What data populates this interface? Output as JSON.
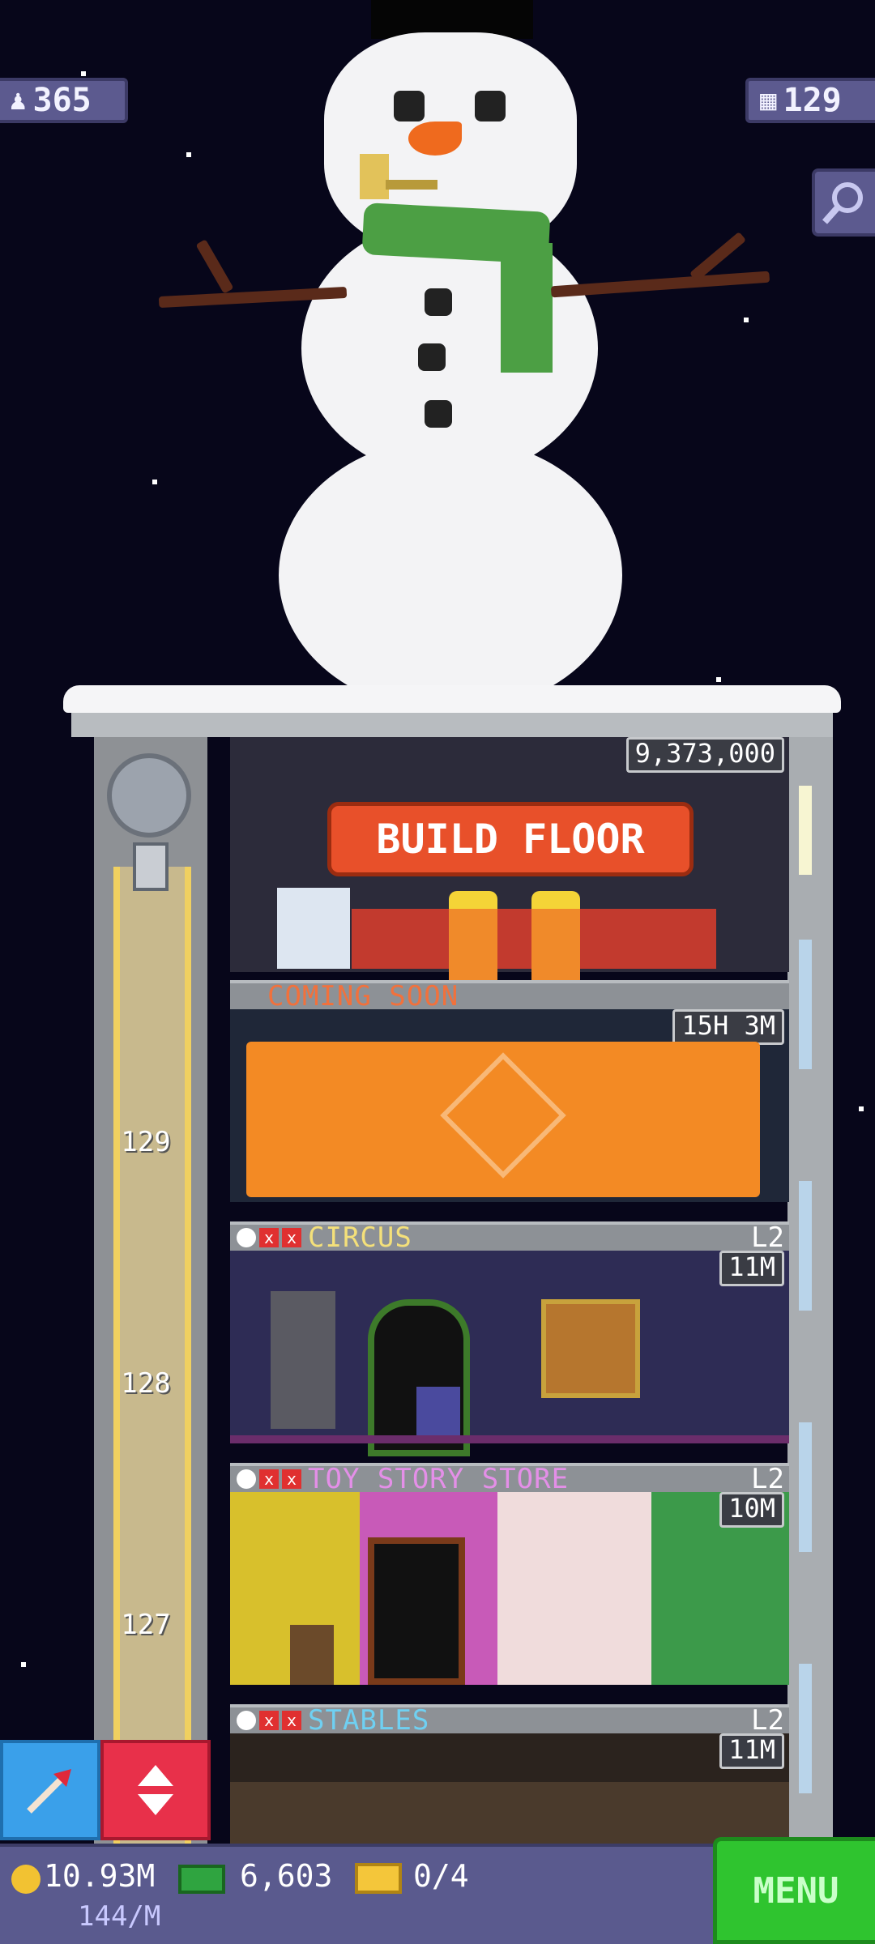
{
  "top_stats": {
    "population_icon": "person-icon",
    "population": "365",
    "floors_icon": "building-icon",
    "floors": "129",
    "search_icon": "magnifier-icon"
  },
  "build_floor": {
    "price": "9,373,000",
    "button_label": "BUILD FLOOR"
  },
  "floors": [
    {
      "status": "COMING SOON",
      "timer": "15H 3M",
      "sign_icon": "construction-worker-icon"
    },
    {
      "name": "CIRCUS",
      "name_color": "#f4e07a",
      "level": "L2",
      "timer": "11M"
    },
    {
      "name": "TOY STORY STORE",
      "name_color": "#e48fe8",
      "level": "L2",
      "timer": "10M"
    },
    {
      "name": "STABLES",
      "name_color": "#6fd0f2",
      "level": "L2",
      "timer": "11M"
    }
  ],
  "elevator": {
    "floor_numbers": [
      "129",
      "128",
      "127"
    ]
  },
  "tools": {
    "raise_icon": "arrow-raise-icon",
    "elevator_icon": "up-down-arrows-icon"
  },
  "bottom_bar": {
    "coins": "10.93M",
    "coins_rate": "144/M",
    "bux": "6,603",
    "tickets": "0/4",
    "menu_label": "MENU"
  }
}
